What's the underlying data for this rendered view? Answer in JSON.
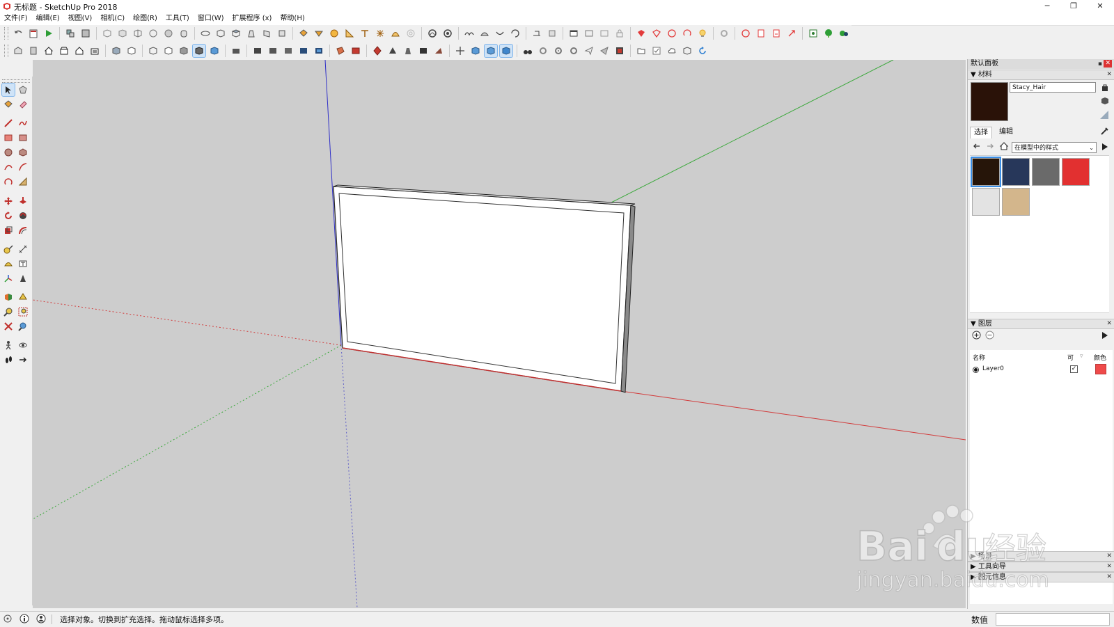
{
  "window": {
    "title": "无标题 - SketchUp Pro 2018",
    "minimize": "─",
    "restore": "❐",
    "close": "✕"
  },
  "menu": [
    "文件(F)",
    "编辑(E)",
    "视图(V)",
    "相机(C)",
    "绘图(R)",
    "工具(T)",
    "窗口(W)",
    "扩展程序 (x)",
    "帮助(H)"
  ],
  "tray": {
    "title": "默认面板",
    "materials": {
      "header": "材料",
      "current_name": "Stacy_Hair",
      "current_color": "#2a1208",
      "tab_select": "选择",
      "tab_edit": "编辑",
      "collection": "在模型中的样式",
      "swatches": [
        {
          "name": "Stacy_Hair",
          "color": "#261509",
          "selected": true
        },
        {
          "name": "navy",
          "color": "#27375a",
          "selected": false
        },
        {
          "name": "gray",
          "color": "#6a6a6a",
          "selected": false
        },
        {
          "name": "red",
          "color": "#e23030",
          "selected": false
        },
        {
          "name": "default",
          "color": "#e3e3e3",
          "selected": false
        },
        {
          "name": "tan",
          "color": "#d3b68c",
          "selected": false
        }
      ]
    },
    "layers": {
      "header": "图层",
      "col_name": "名称",
      "col_visible": "可",
      "col_color": "颜色",
      "rows": [
        {
          "name": "Layer0",
          "visible": true,
          "color": "#ef4a4a"
        }
      ]
    },
    "collapsed_panels": [
      "场景",
      "工具向导",
      "图元信息"
    ]
  },
  "status": {
    "message": "选择对象。切换到扩充选择。拖动鼠标选择多项。",
    "value_label": "数值",
    "value": ""
  },
  "watermark": {
    "brand": "Bai",
    "brand2": "du",
    "cn": "经验",
    "url": "jingyan.baidu.com"
  }
}
